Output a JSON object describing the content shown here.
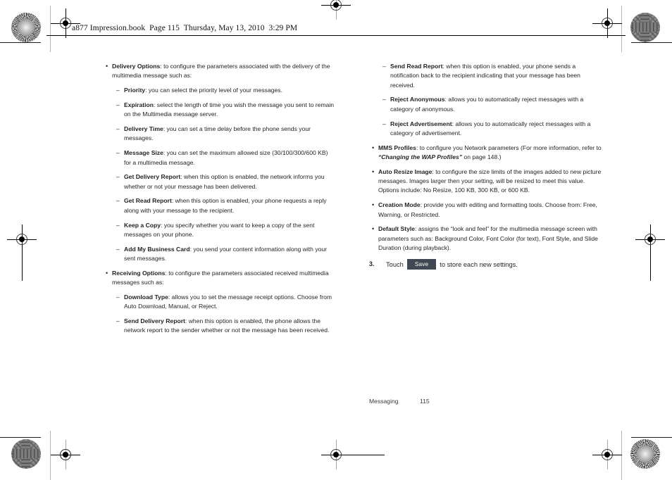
{
  "header": {
    "text": "a877 Impression.book  Page 115  Thursday, May 13, 2010  3:29 PM"
  },
  "left_column": [
    {
      "level": 1,
      "marker": "•",
      "term": "Delivery Options",
      "text": ": to configure the parameters associated with the delivery of the multimedia message such as:"
    },
    {
      "level": 2,
      "marker": "–",
      "term": "Priority",
      "text": ": you can select the priority level of your messages."
    },
    {
      "level": 2,
      "marker": "–",
      "term": "Expiration",
      "text": ": select the length of time you wish the message you sent to remain on the Multimedia message server."
    },
    {
      "level": 2,
      "marker": "–",
      "term": "Delivery Time",
      "text": ": you can set a time delay before the phone sends your messages."
    },
    {
      "level": 2,
      "marker": "–",
      "term": "Message Size",
      "text": ": you can set the maximum allowed size (30/100/300/600 KB) for a multimedia message."
    },
    {
      "level": 2,
      "marker": "–",
      "term": "Get Delivery Report",
      "text": ": when this option is enabled, the network informs you whether or not your message has been delivered."
    },
    {
      "level": 2,
      "marker": "–",
      "term": "Get Read Report",
      "text": ": when this option is enabled, your phone requests a reply along with your message to the recipient."
    },
    {
      "level": 2,
      "marker": "–",
      "term": "Keep a Copy",
      "text": ": you specify whether you want to keep a copy of the sent messages on your phone."
    },
    {
      "level": 2,
      "marker": "–",
      "term": "Add My Business Card",
      "text": ": you send your content information along with your sent messages."
    },
    {
      "level": 1,
      "marker": "•",
      "term": "Receiving Options",
      "text": ": to configure the parameters associated received multimedia messages such as:"
    },
    {
      "level": 2,
      "marker": "–",
      "term": "Download Type",
      "text": ": allows you to set the message receipt options. Choose from Auto Download, Manual, or Reject."
    },
    {
      "level": 2,
      "marker": "–",
      "term": "Send Delivery Report",
      "text": ": when this option is enabled, the phone allows the network report to the sender whether or not the message has been received."
    }
  ],
  "right_column": [
    {
      "level": 2,
      "marker": "–",
      "term": "Send Read Report",
      "text": ": when this option is enabled, your phone sends a notification back to the recipient indicating that your message has been received."
    },
    {
      "level": 2,
      "marker": "–",
      "term": "Reject Anonymous",
      "text": ": allows you to automatically reject messages with a category of anonymous."
    },
    {
      "level": 2,
      "marker": "–",
      "term": "Reject Advertisement",
      "text": ": allows you to automatically reject messages with a category of advertisement."
    },
    {
      "level": 1,
      "marker": "•",
      "term": "MMS Profiles",
      "text": ": to configure you Network parameters (For more information, refer to ",
      "italic": "“Changing the WAP Profiles”",
      "text_after": " on page 148.)"
    },
    {
      "level": 1,
      "marker": "•",
      "term": "Auto Resize Image",
      "text": ": to configure the size limits of the images added to new picture messages. Images larger then your setting, will be resized to meet this value. Options include: No Resize, 100 KB, 300 KB, or 600 KB."
    },
    {
      "level": 1,
      "marker": "•",
      "term": "Creation Mode",
      "text": ": provide you with editing and formatting tools. Choose from: Free, Warning, or Restricted."
    },
    {
      "level": 1,
      "marker": "•",
      "term": "Default Style",
      "text": ": assigns the “look and feel” for the multimedia message screen with parameters such as: Background Color, Font Color (for text), Font Style, and Slide Duration (during playback)."
    }
  ],
  "step": {
    "number": "3.",
    "text_before": "Touch",
    "button_label": "Save",
    "text_after": "to store each new settings."
  },
  "footer": {
    "chapter": "Messaging",
    "page_number": "115"
  },
  "colors": {
    "text": "#231f20",
    "button_bg": "#3f4853",
    "button_text": "#ffffff",
    "rule": "#000000"
  }
}
